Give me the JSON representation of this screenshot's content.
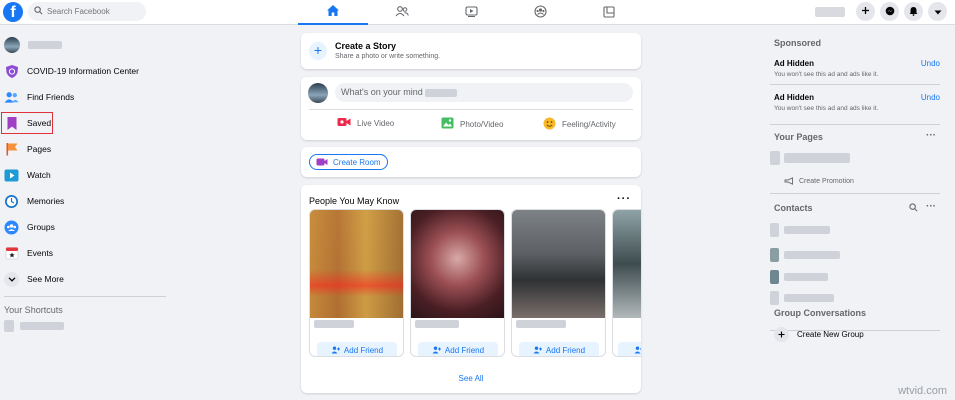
{
  "header": {
    "logo_letter": "f",
    "search_placeholder": "Search Facebook"
  },
  "nav_tabs": [
    {
      "icon": "home-icon",
      "active": true
    },
    {
      "icon": "friends-icon",
      "active": false
    },
    {
      "icon": "watch-icon",
      "active": false
    },
    {
      "icon": "groups-icon",
      "active": false
    },
    {
      "icon": "gaming-icon",
      "active": false
    }
  ],
  "sidebar": {
    "items": [
      {
        "label": "COVID-19 Information Center",
        "icon": "covid-shield-icon"
      },
      {
        "label": "Find Friends",
        "icon": "friends-icon"
      },
      {
        "label": "Saved",
        "icon": "bookmark-icon"
      },
      {
        "label": "Pages",
        "icon": "flag-icon"
      },
      {
        "label": "Watch",
        "icon": "watch-icon"
      },
      {
        "label": "Memories",
        "icon": "clock-icon"
      },
      {
        "label": "Groups",
        "icon": "groups-icon"
      },
      {
        "label": "Events",
        "icon": "calendar-icon"
      },
      {
        "label": "See More",
        "icon": "chevron-down-icon"
      }
    ],
    "shortcuts_title": "Your Shortcuts"
  },
  "story": {
    "title": "Create a Story",
    "subtitle": "Share a photo or write something."
  },
  "composer": {
    "placeholder": "What's on your mind",
    "actions": [
      {
        "label": "Live Video",
        "icon": "live-video-icon"
      },
      {
        "label": "Photo/Video",
        "icon": "photo-icon"
      },
      {
        "label": "Feeling/Activity",
        "icon": "smiley-icon"
      }
    ]
  },
  "room": {
    "label": "Create Room"
  },
  "pymk": {
    "title": "People You May Know",
    "add_label": "Add Friend",
    "see_all": "See All"
  },
  "right": {
    "sponsored_title": "Sponsored",
    "ads": [
      {
        "title": "Ad Hidden",
        "subtitle": "You won't see this ad and ads like it.",
        "undo": "Undo"
      },
      {
        "title": "Ad Hidden",
        "subtitle": "You won't see this ad and ads like it.",
        "undo": "Undo"
      }
    ],
    "pages_title": "Your Pages",
    "create_promotion": "Create Promotion",
    "contacts_title": "Contacts",
    "group_conv_title": "Group Conversations",
    "new_group": "Create New Group"
  },
  "watermark": "wtvid.com",
  "colors": {
    "brand": "#1877f2",
    "highlight": "#e0323c",
    "background": "#f0f2f5"
  }
}
